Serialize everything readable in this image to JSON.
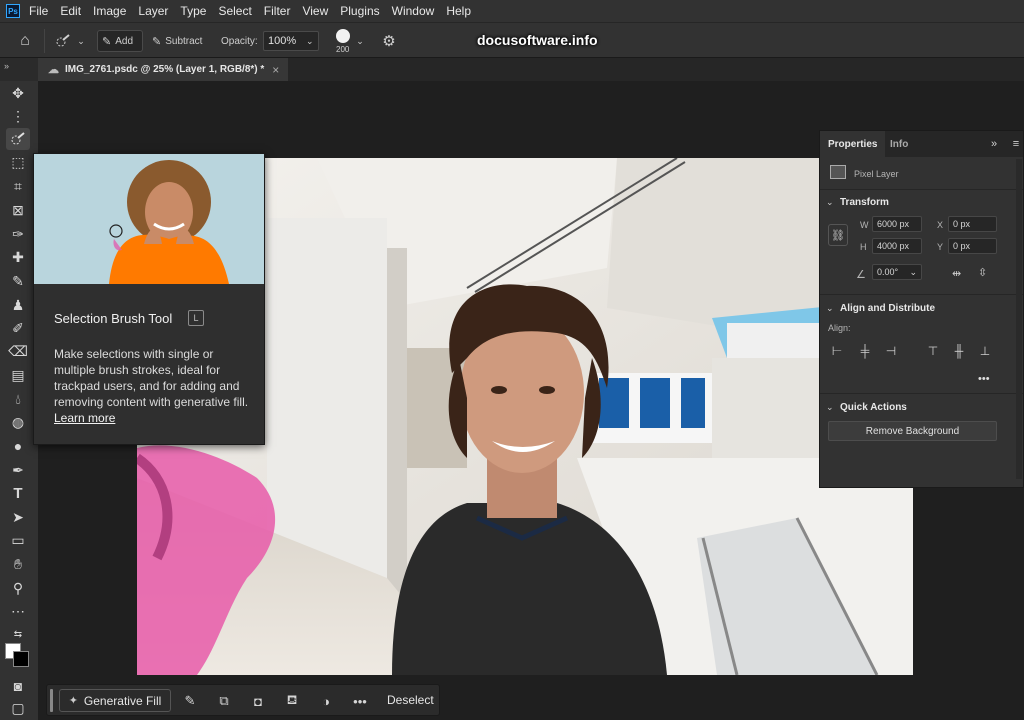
{
  "menu": {
    "logo": "Ps",
    "items": [
      "File",
      "Edit",
      "Image",
      "Layer",
      "Type",
      "Select",
      "Filter",
      "View",
      "Plugins",
      "Window",
      "Help"
    ]
  },
  "options": {
    "add_label": "Add",
    "subtract_label": "Subtract",
    "opacity_label": "Opacity:",
    "opacity_value": "100%",
    "brush_size": "200",
    "watermark": "docusoftware.info"
  },
  "tab": {
    "title": "IMG_2761.psdc @ 25% (Layer 1, RGB/8*) *",
    "close": "×",
    "chevron": "»"
  },
  "tooltip": {
    "title": "Selection Brush Tool",
    "shortcut": "L",
    "description": "Make selections with single or multiple brush strokes, ideal for trackpad users, and for adding and removing content with generative fill.",
    "learn_more": "Learn more"
  },
  "properties": {
    "tab_properties": "Properties",
    "tab_info": "Info",
    "layer_type": "Pixel Layer",
    "transform_header": "Transform",
    "w_label": "W",
    "w_value": "6000 px",
    "h_label": "H",
    "h_value": "4000 px",
    "x_label": "X",
    "x_value": "0 px",
    "y_label": "Y",
    "y_value": "0 px",
    "angle_value": "0.00°",
    "align_header": "Align and Distribute",
    "align_label": "Align:",
    "quick_header": "Quick Actions",
    "remove_bg": "Remove Background"
  },
  "taskbar": {
    "generative_fill": "Generative Fill",
    "deselect": "Deselect",
    "more": "•••"
  },
  "colors": {
    "accent": "#31a8ff",
    "selection_overlay": "#e85aa9",
    "panel_bg": "#323232"
  }
}
